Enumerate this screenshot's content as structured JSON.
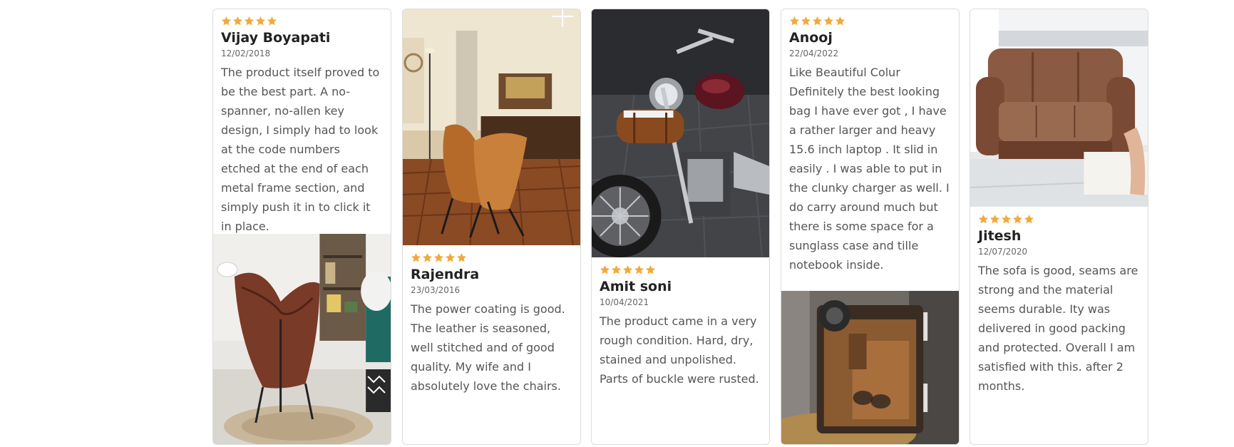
{
  "reviews": [
    {
      "rating": 5,
      "name": "Vijay Boyapati",
      "date": "12/02/2018",
      "text": "The product itself proved to be the best part. A no-spanner, no-allen key design, I simply had to look at the code numbers etched at the end of each metal frame section, and simply push it in to click it in place."
    },
    {
      "rating": 5,
      "name": "Rajendra",
      "date": "23/03/2016",
      "text": "The power coating is good. The leather is seasoned, well stitched and of good quality. My wife and I absolutely love the chairs."
    },
    {
      "rating": 5,
      "name": "Amit soni",
      "date": "10/04/2021",
      "text": "The product came in a very rough condition. Hard, dry, stained and unpolished. Parts of buckle were rusted."
    },
    {
      "rating": 5,
      "name": "Anooj",
      "date": "22/04/2022",
      "text": "Like Beautiful Colur Definitely the best looking bag I have ever got , I have a rather larger and heavy 15.6 inch laptop . It slid in easily . I was able to put in the clunky charger as well. I do carry around much but there is some space for a sunglass case and tille notebook inside."
    },
    {
      "rating": 5,
      "name": "Jitesh",
      "date": "12/07/2020",
      "text": "The sofa is good, seams are strong and the material seems durable. Ity was delivered in good packing and protected. Overall I am satisfied with this. after 2 months."
    }
  ],
  "icons": {
    "star": "star-icon"
  },
  "colors": {
    "star": "#f2a93b",
    "name": "#222222",
    "body": "#555555",
    "border": "#dcdcdc"
  }
}
